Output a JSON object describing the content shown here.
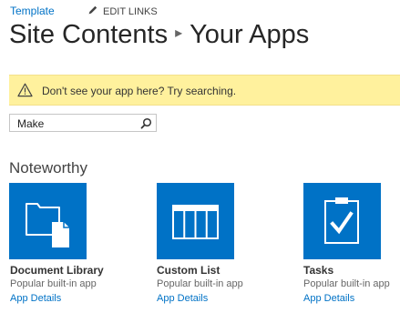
{
  "breadcrumb": {
    "link": "Template",
    "edit_links": "EDIT LINKS"
  },
  "title": {
    "part1": "Site Contents",
    "separator": "▸",
    "part2": "Your Apps"
  },
  "banner": {
    "message": "Don't see your app here? Try searching."
  },
  "search": {
    "value": "Make",
    "icon": "search-icon"
  },
  "section": {
    "heading": "Noteworthy"
  },
  "apps": [
    {
      "name": "Document Library",
      "subtitle": "Popular built-in app",
      "link": "App Details",
      "icon": "document-library-icon"
    },
    {
      "name": "Custom List",
      "subtitle": "Popular built-in app",
      "link": "App Details",
      "icon": "custom-list-icon"
    },
    {
      "name": "Tasks",
      "subtitle": "Popular built-in app",
      "link": "App Details",
      "icon": "tasks-icon"
    }
  ],
  "colors": {
    "accent": "#0072c6",
    "banner": "#fff19d",
    "tile": "#0072c6"
  }
}
